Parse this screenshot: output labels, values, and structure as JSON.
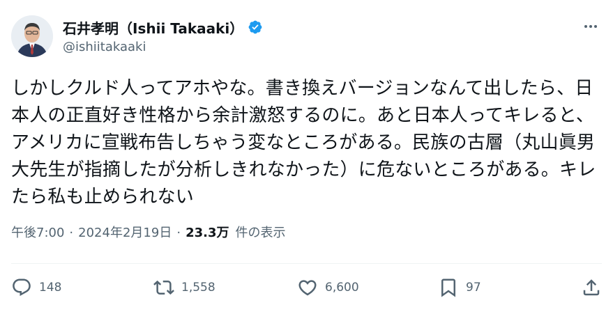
{
  "author": {
    "display_name": "石井孝明（Ishii Takaaki）",
    "handle": "@ishiitakaaki",
    "verified_color": "#1d9bf0"
  },
  "icons": {
    "more": "more-horizontal-icon",
    "reply": "comment-bubble-icon",
    "retweet": "retweet-arrows-icon",
    "like": "heart-icon",
    "bookmark": "bookmark-icon",
    "share": "share-upload-icon"
  },
  "tweet": {
    "text": "しかしクルド人ってアホやな。書き換えバージョンなんて出したら、日本人の正直好き性格から余計激怒するのに。あと日本人ってキレると、アメリカに宣戦布告しちゃう変なところがある。民族の古層（丸山眞男大先生が指摘したが分析しきれなかった）に危ないところがある。キレたら私も止められない"
  },
  "meta": {
    "time": "午後7:00",
    "separator": "·",
    "date": "2024年2月19日",
    "views_count": "23.3万",
    "views_label": "件の表示"
  },
  "actions": {
    "replies": "148",
    "retweets": "1,558",
    "likes": "6,600",
    "bookmarks": "97"
  },
  "colors": {
    "text_primary": "#0f1419",
    "text_secondary": "#536471",
    "divider": "#eff3f4"
  }
}
